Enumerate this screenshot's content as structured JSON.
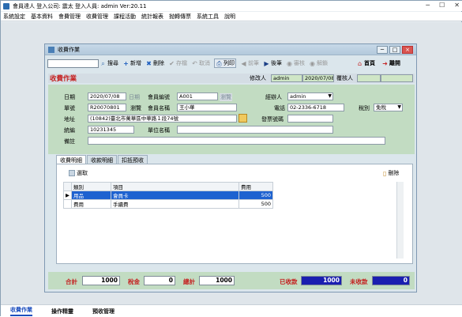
{
  "app": {
    "title": "會員達人  登入公司: 震太  登入人員: admin Ver:20.11",
    "win_min": "─",
    "win_max": "☐",
    "win_close": "✕"
  },
  "menu": [
    "系統設定",
    "基本資料",
    "會費管理",
    "收費管理",
    "課程活動",
    "統計報表",
    "抛轉傳票",
    "系統工具",
    "說明"
  ],
  "child": {
    "title": "收費作業",
    "btn_min": "─",
    "btn_max": "□",
    "btn_close": "×"
  },
  "toolbar": {
    "search_placeholder": "",
    "search": "搜尋",
    "add": "新增",
    "delete": "刪除",
    "save": "存檔",
    "cancel": "取消",
    "print": "列印",
    "prev": "前筆",
    "next": "後筆",
    "lock": "審核",
    "unlock": "解鎖",
    "home": "首頁",
    "exit": "離開"
  },
  "header": {
    "heading": "收費作業",
    "editor_label": "修改人",
    "editor": "admin",
    "edit_date": "2020/07/08",
    "checker_label": "覆核人"
  },
  "form": {
    "date_label": "日期",
    "date": "2020/07/08",
    "date_suffix": "日期",
    "member_no_label": "會員編號",
    "member_no": "A001",
    "browse": "瀏覽",
    "handler_label": "經辦人",
    "handler": "admin",
    "bill_label": "單號",
    "bill_no": "R20070801",
    "bill_browse": "瀏覽",
    "member_name_label": "會員名稱",
    "member_name": "王小華",
    "phone_label": "電話",
    "phone": "02-2336-6718",
    "tax_label": "稅別",
    "tax": "免稅",
    "address_label": "地址",
    "address": "(10842)臺北市萬華區中華路１段74號",
    "invoice_label": "發票號碼",
    "invoice": "",
    "taxid_label": "統編",
    "taxid": "10231345",
    "unit_label": "單位名稱",
    "unit": "",
    "note_label": "備註",
    "note": ""
  },
  "tabs": [
    "收費明細",
    "收款明細",
    "扣抵預收"
  ],
  "detail": {
    "pick": "選取",
    "remove": "刪除",
    "columns": [
      "類別",
      "項目",
      "費用"
    ],
    "rows": [
      {
        "cat": "用品",
        "item": "會員卡",
        "fee": "500"
      },
      {
        "cat": "費用",
        "item": "手續費",
        "fee": "500"
      }
    ]
  },
  "totals": {
    "sum_label": "合計",
    "sum": "1000",
    "tax_label": "稅金",
    "tax": "0",
    "total_label": "總計",
    "total": "1000",
    "received_label": "已收款",
    "received": "1000",
    "unreceived_label": "未收款",
    "unreceived": "0"
  },
  "bottom_tabs": [
    "收費作業",
    "操作精靈",
    "預收管理"
  ]
}
